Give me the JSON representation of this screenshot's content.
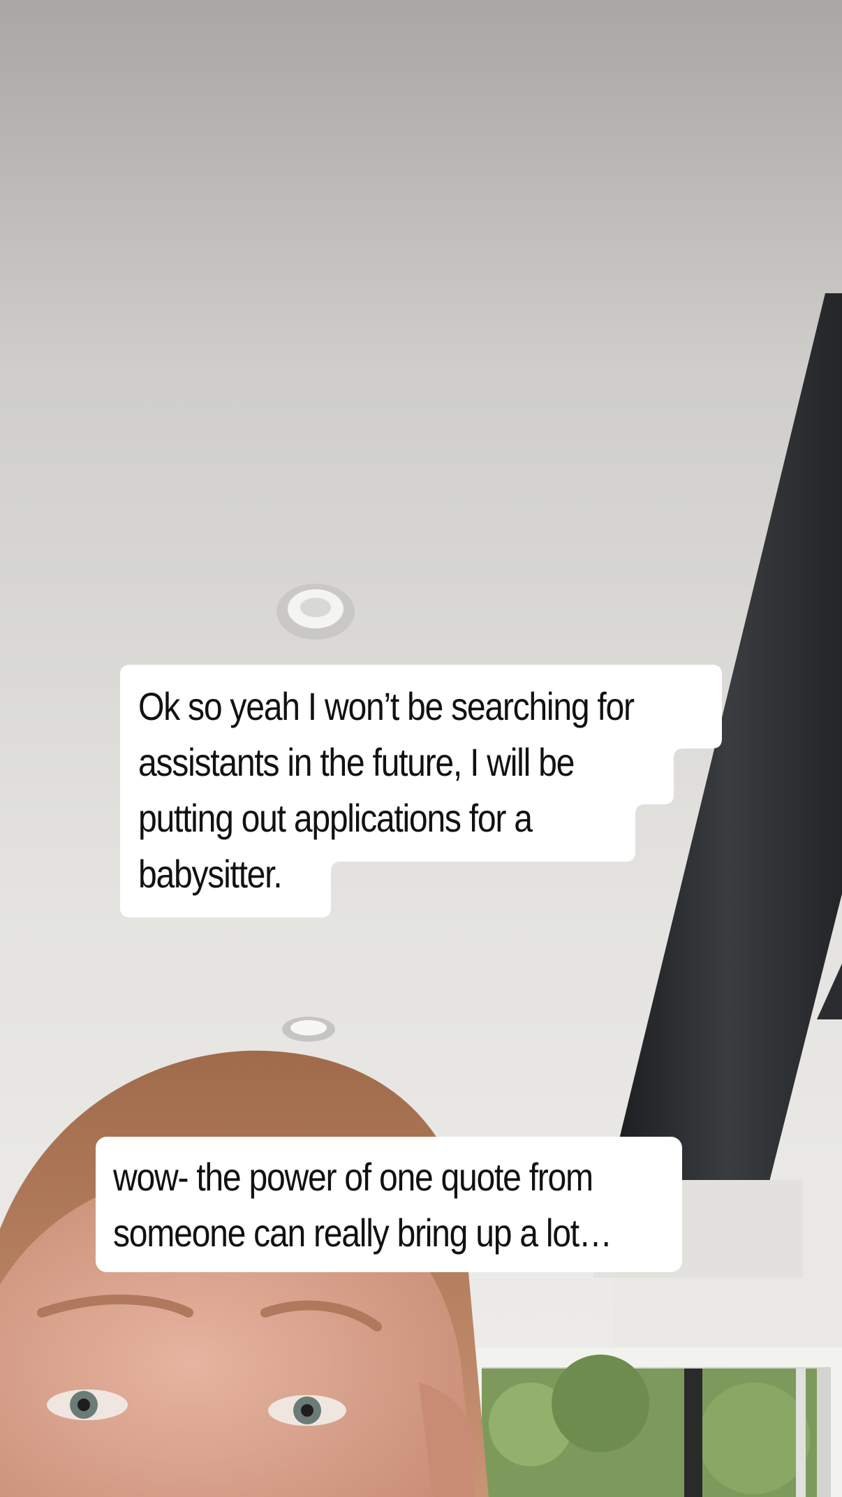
{
  "story": {
    "captions": [
      {
        "lines": [
          "Ok so yeah I won’t be searching for",
          "assistants in the future, I will be",
          "putting out applications for a",
          "babysitter."
        ]
      },
      {
        "lines": [
          "wow- the power of one quote from",
          "someone can really bring up a lot…"
        ]
      }
    ]
  },
  "colors": {
    "caption_bg": "#ffffff",
    "caption_text": "#111111",
    "ceiling": "#ddddda",
    "beam": "#26292c",
    "hair": "#b87e5c",
    "skin": "#d9a08c",
    "foliage": "#7d9a5c"
  }
}
